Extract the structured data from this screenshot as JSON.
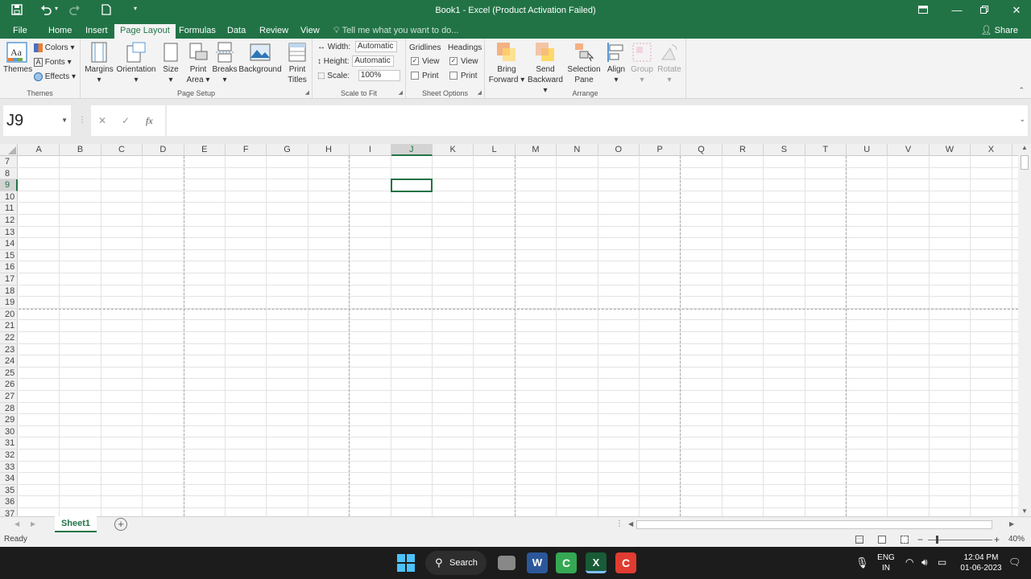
{
  "title_bar": {
    "window_title": "Book1 - Excel (Product Activation Failed)",
    "quick_access": {
      "save_icon": "save-icon",
      "undo_icon": "undo-icon",
      "redo_icon": "redo-icon",
      "new_icon": "new-file-icon",
      "customize_icon": "chevron-down-icon"
    },
    "window_buttons": [
      "ribbon-display-icon",
      "minimize-icon",
      "restore-icon",
      "close-icon"
    ]
  },
  "tabs": {
    "items": [
      "File",
      "Home",
      "Insert",
      "Page Layout",
      "Formulas",
      "Data",
      "Review",
      "View"
    ],
    "active": "Page Layout",
    "tell_me": "Tell me what you want to do...",
    "share": "Share"
  },
  "ribbon": {
    "themes": {
      "themes": "Themes",
      "colors": "Colors",
      "fonts": "Fonts",
      "effects": "Effects",
      "group": "Themes"
    },
    "page_setup": {
      "margins": "Margins",
      "orientation": "Orientation",
      "size": "Size",
      "print_area_1": "Print",
      "print_area_2": "Area",
      "breaks": "Breaks",
      "background": "Background",
      "print_titles_1": "Print",
      "print_titles_2": "Titles",
      "group": "Page Setup"
    },
    "scale_to_fit": {
      "width_label": "Width:",
      "width_value": "Automatic",
      "height_label": "Height:",
      "height_value": "Automatic",
      "scale_label": "Scale:",
      "scale_value": "100%",
      "group": "Scale to Fit"
    },
    "sheet_options": {
      "gridlines": "Gridlines",
      "headings": "Headings",
      "view": "View",
      "print": "Print",
      "gridlines_view": true,
      "gridlines_print": false,
      "headings_view": true,
      "headings_print": false,
      "group": "Sheet Options"
    },
    "arrange": {
      "bring_1": "Bring",
      "bring_2": "Forward",
      "send_1": "Send",
      "send_2": "Backward",
      "selection_1": "Selection",
      "selection_2": "Pane",
      "align": "Align",
      "group_btn": "Group",
      "rotate": "Rotate",
      "group": "Arrange"
    }
  },
  "formula_bar": {
    "name_box": "J9",
    "fx": "fx",
    "formula": ""
  },
  "grid": {
    "columns": [
      "A",
      "B",
      "C",
      "D",
      "E",
      "F",
      "G",
      "H",
      "I",
      "J",
      "K",
      "L",
      "M",
      "N",
      "O",
      "P",
      "Q",
      "R",
      "S",
      "T",
      "U",
      "V",
      "W",
      "X"
    ],
    "rows": [
      "7",
      "8",
      "9",
      "10",
      "11",
      "12",
      "13",
      "14",
      "15",
      "16",
      "17",
      "18",
      "19",
      "20",
      "21",
      "22",
      "23",
      "24",
      "25",
      "26",
      "27",
      "28",
      "29",
      "30",
      "31",
      "32",
      "33",
      "34",
      "35",
      "36",
      "37"
    ],
    "selected_cell": "J9"
  },
  "sheets": {
    "tabs": [
      "Sheet1"
    ],
    "active": "Sheet1"
  },
  "status_bar": {
    "status": "Ready",
    "zoom": "40%"
  },
  "taskbar": {
    "search": "Search",
    "language_1": "ENG",
    "language_2": "IN",
    "time": "12:04 PM",
    "date": "01-06-2023"
  },
  "colors": {
    "excel_green": "#217346",
    "ribbon_bg": "#f3f3f3",
    "taskbar_bg": "#1c1c1c"
  }
}
